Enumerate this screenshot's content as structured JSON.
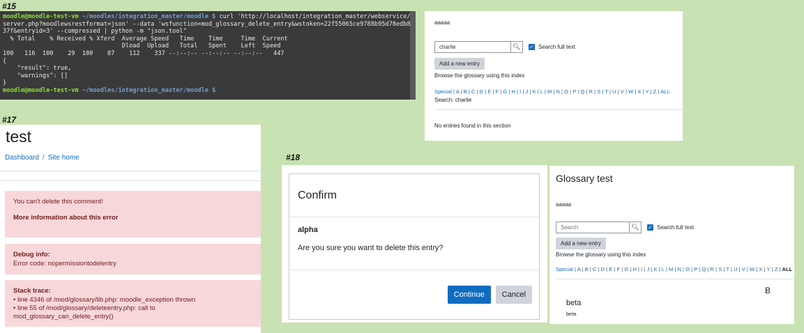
{
  "labels": {
    "t15": "#15",
    "t17": "#17",
    "t18": "#18"
  },
  "terminal": {
    "lines": [
      {
        "user": "moodle@moodle-test-vm",
        "path": " ~/moodles/integration_master/moodle $",
        "text": " curl 'http://localhost/integration_master/webservice/rest/"
      },
      {
        "text": "server.php?moodlewsrestformat=json' --data 'wsfunction=mod_glossary_delete_entry&wstoken=22f55065ce9788b95d78edb83d2d3"
      },
      {
        "text": "37f&entryid=3' --compressed | python -m \"json.tool\""
      },
      {
        "text": "  % Total    % Received % Xferd  Average Speed   Time    Time     Time  Current"
      },
      {
        "text": "                                 Dload  Upload   Total   Spent    Left  Speed"
      },
      {
        "text": "100   116  100    29  100    87    112    337 --:--:-- --:--:-- --:--:--   447"
      },
      {
        "text": "{"
      },
      {
        "text": "    \"result\": true,"
      },
      {
        "text": "    \"warnings\": []"
      },
      {
        "text": "}"
      },
      {
        "user": "moodle@moodle-test-vm",
        "path": " ~/moodles/integration_master/moodle $",
        "text": ""
      }
    ]
  },
  "glossary15": {
    "intro": "aaaaa",
    "search_value": "charlie",
    "fulltext_label": "Search full text",
    "add_button": "Add a new entry",
    "browse_label": "Browse the glossary using this index",
    "alphabet": [
      "Special",
      "A",
      "B",
      "C",
      "D",
      "E",
      "F",
      "G",
      "H",
      "I",
      "J",
      "K",
      "L",
      "M",
      "N",
      "O",
      "P",
      "Q",
      "R",
      "S",
      "T",
      "U",
      "V",
      "W",
      "X",
      "Y",
      "Z",
      "ALL"
    ],
    "search_status": "Search: charlie",
    "empty_msg": "No entries found in this section"
  },
  "error17": {
    "title": "test",
    "crumb_dashboard": "Dashboard",
    "crumb_site": "Site home",
    "message": "You can't delete this comment!",
    "more_info": "More information about this error",
    "debug_title": "Debug info:",
    "debug_text": "Error code: nopermissiontodelentry",
    "stack_title": "Stack trace:",
    "stack": [
      "line 4346 of /mod/glossary/lib.php: moodle_exception thrown",
      "line 55 of /mod/glossary/deleteentry.php: call to mod_glossary_can_delete_entry()"
    ]
  },
  "confirm18": {
    "title": "Confirm",
    "entry": "alpha",
    "question": "Are you sure you want to delete this entry?",
    "continue": "Continue",
    "cancel": "Cancel"
  },
  "glossary18": {
    "title": "Glossary test",
    "intro": "aaaaa",
    "search_placeholder": "Search",
    "fulltext_label": "Search full text",
    "add_button": "Add a new entry",
    "browse_label": "Browse the glossary using this index",
    "alphabet": [
      "Special",
      "A",
      "B",
      "C",
      "D",
      "E",
      "F",
      "G",
      "H",
      "I",
      "J",
      "K",
      "L",
      "M",
      "N",
      "O",
      "P",
      "Q",
      "R",
      "S",
      "T",
      "U",
      "V",
      "W",
      "X",
      "Y",
      "Z",
      "ALL"
    ],
    "letter_heading": "B",
    "entry_title": "beta",
    "entry_text": "beta"
  },
  "colors": {
    "background": "#c9e2b3",
    "link": "#0f6cbf",
    "error_bg": "#f8d7da"
  }
}
